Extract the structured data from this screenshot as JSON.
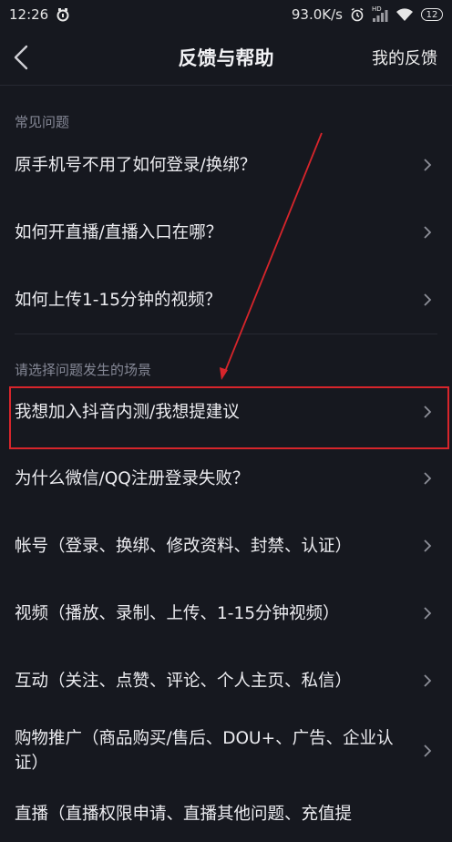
{
  "status_bar": {
    "time": "12:26",
    "network_speed": "93.0K/s",
    "network_badge": "HD",
    "battery": "12",
    "icons": [
      "app-notification-icon",
      "alarm-icon",
      "signal-icon",
      "wifi-icon",
      "battery-icon"
    ]
  },
  "nav": {
    "back_icon": "chevron-left-icon",
    "title": "反馈与帮助",
    "right_label": "我的反馈"
  },
  "faq": {
    "header": "常见问题",
    "items": [
      {
        "label": "原手机号不用了如何登录/换绑？"
      },
      {
        "label": "如何开直播/直播入口在哪？"
      },
      {
        "label": "如何上传1-15分钟的视频？"
      }
    ]
  },
  "scenarios": {
    "header": "请选择问题发生的场景",
    "items": [
      {
        "label": "我想加入抖音内测/我想提建议"
      },
      {
        "label": "为什么微信/QQ注册登录失败？"
      },
      {
        "label": "帐号（登录、换绑、修改资料、封禁、认证）"
      },
      {
        "label": "视频（播放、录制、上传、1-15分钟视频）"
      },
      {
        "label": "互动（关注、点赞、评论、个人主页、私信）"
      },
      {
        "label": "购物推广（商品购买/售后、DOU+、广告、企业认证）"
      },
      {
        "label": "直播（直播权限申请、直播其他问题、充值提"
      }
    ]
  },
  "annotation": {
    "highlight_color": "#d7252b"
  }
}
